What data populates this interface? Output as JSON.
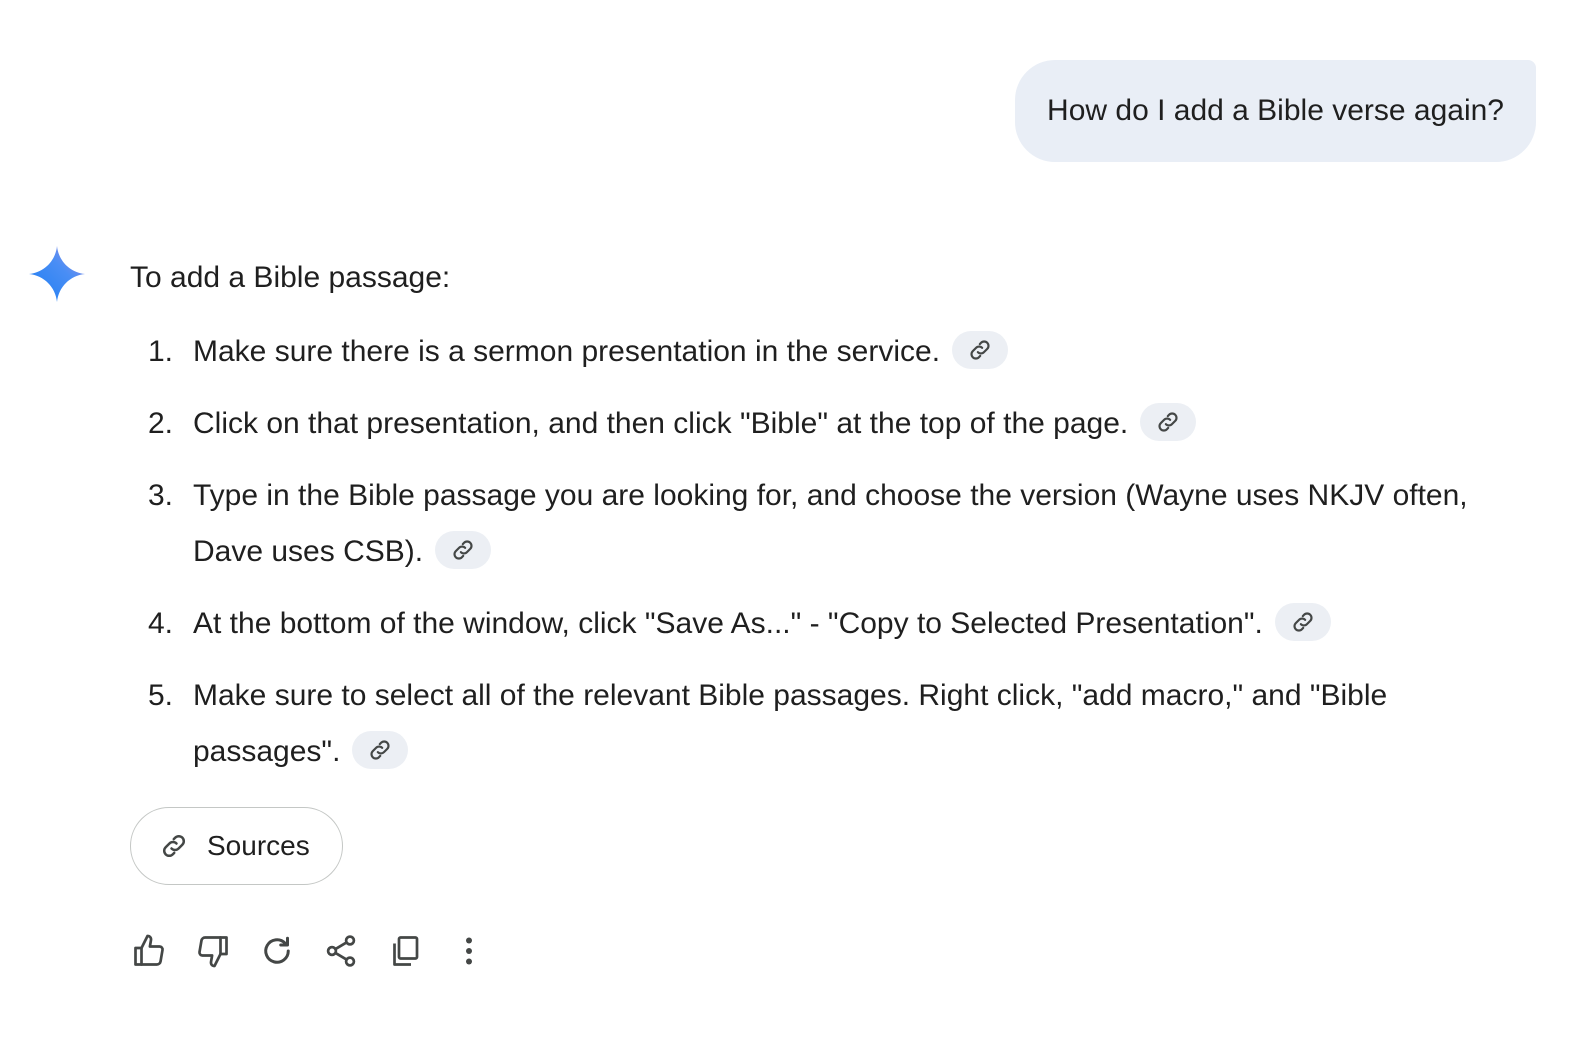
{
  "user_message": "How do I add a Bible verse again?",
  "response": {
    "intro": "To add a Bible passage:",
    "steps": [
      {
        "num": "1.",
        "text": "Make sure there is a sermon presentation in the service."
      },
      {
        "num": "2.",
        "text": "Click on that presentation, and then click \"Bible\" at the top of the page."
      },
      {
        "num": "3.",
        "text": "Type in the Bible passage you are looking for, and choose the version (Wayne uses NKJV often, Dave uses CSB)."
      },
      {
        "num": "4.",
        "text": "At the bottom of the window, click \"Save As...\" - \"Copy to Selected Presentation\"."
      },
      {
        "num": "5.",
        "text": "Make sure to select all of the relevant Bible passages. Right click, \"add macro,\" and \"Bible passages\"."
      }
    ],
    "sources_label": "Sources"
  },
  "icons": {
    "assistant": "sparkle-icon",
    "citation": "link-icon",
    "actions": [
      "thumbs-up-icon",
      "thumbs-down-icon",
      "regenerate-icon",
      "share-icon",
      "copy-icon",
      "more-vert-icon"
    ]
  },
  "colors": {
    "bubble_bg": "#e9eef6",
    "chip_bg": "#eceff4",
    "text": "#1f1f1f",
    "icon": "#444746",
    "spark_start": "#4285f4",
    "spark_end": "#9b72cb"
  }
}
